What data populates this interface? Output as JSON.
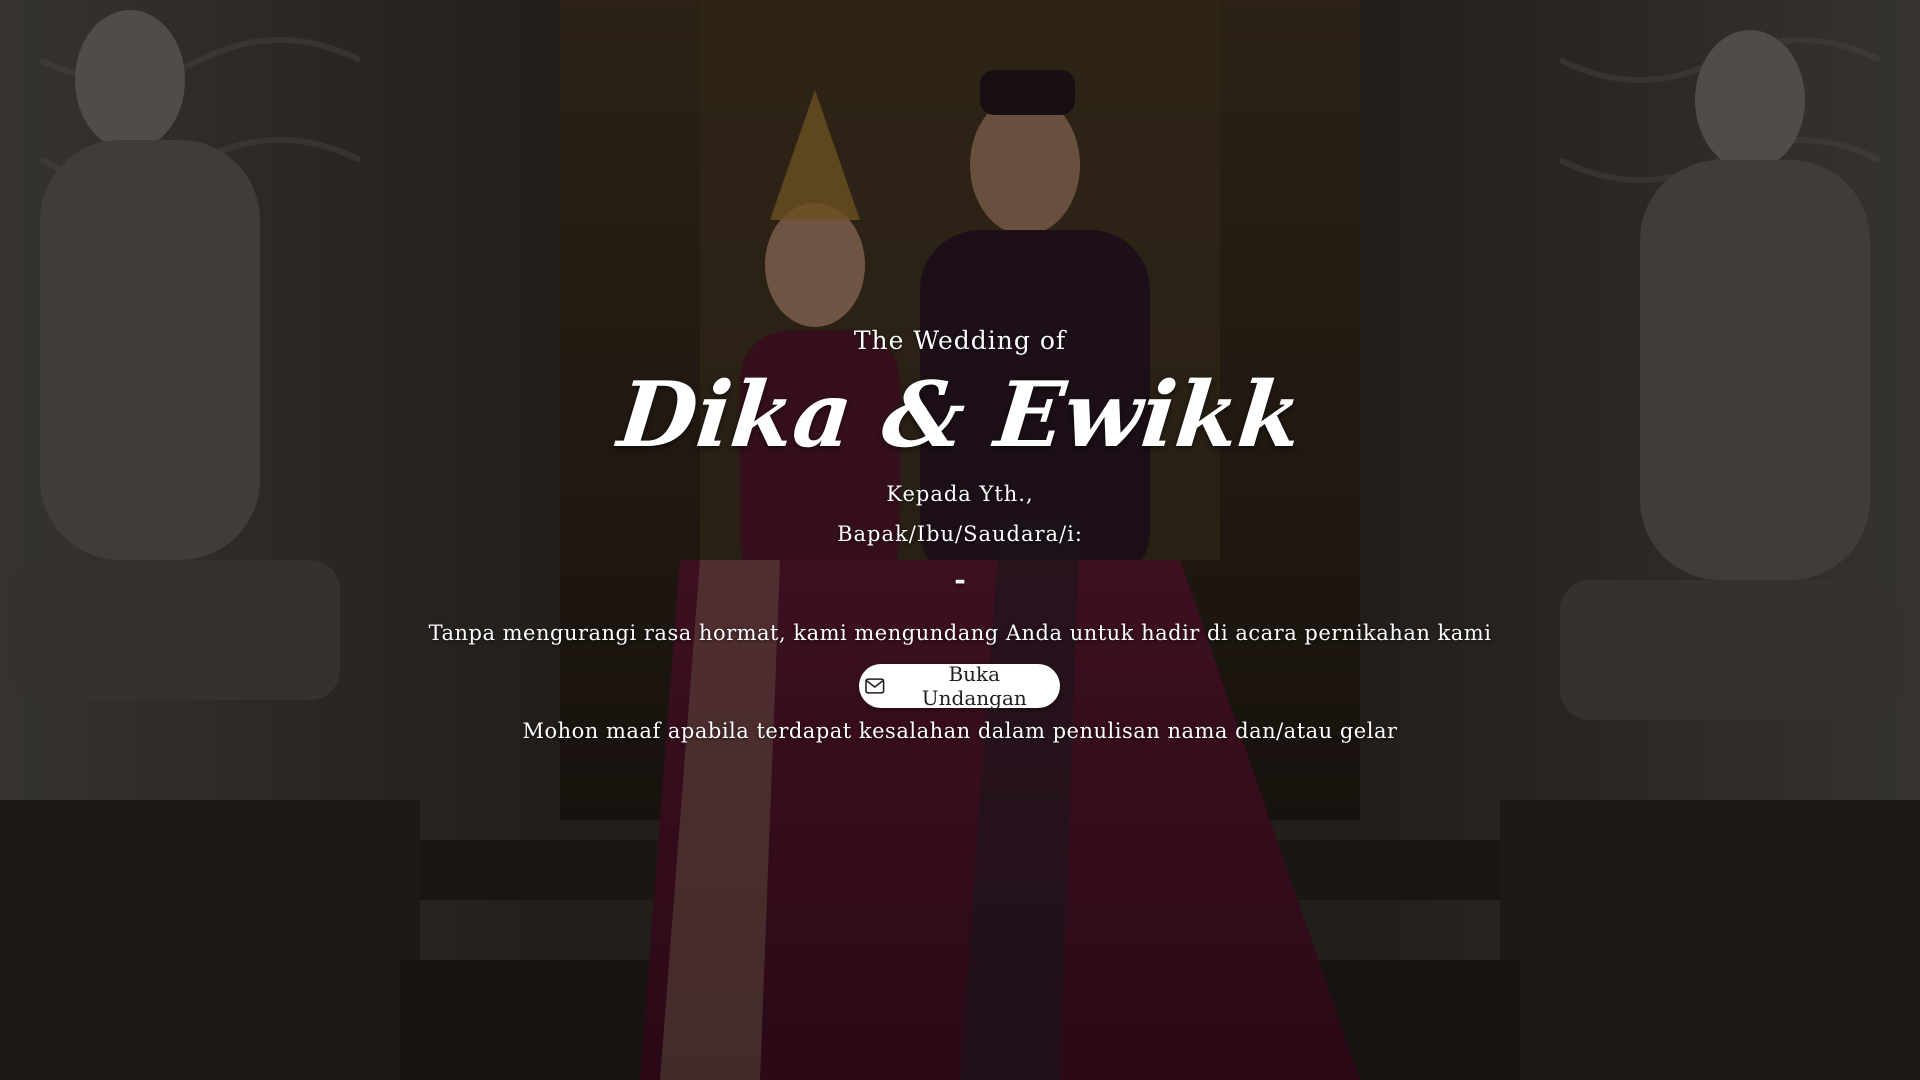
{
  "colors": {
    "overlay": "#000000",
    "text": "#ffffff",
    "button_bg": "#ffffff",
    "button_text": "#1f1f1f",
    "maroon_dress": "#5a1630",
    "stone": "#6e6760"
  },
  "cover": {
    "intro": "The Wedding of",
    "couple_names": "Dika & Ewikk",
    "greeting_line1": "Kepada Yth.,",
    "greeting_line2": "Bapak/Ibu/Saudara/i:",
    "guest_name": "-",
    "message": "Tanpa mengurangi rasa hormat, kami mengundang Anda untuk hadir di acara pernikahan kami",
    "open_button": {
      "label": "Buka Undangan",
      "icon": "envelope-icon"
    },
    "note": "Mohon maaf apabila terdapat kesalahan dalam penulisan nama dan/atau gelar"
  }
}
